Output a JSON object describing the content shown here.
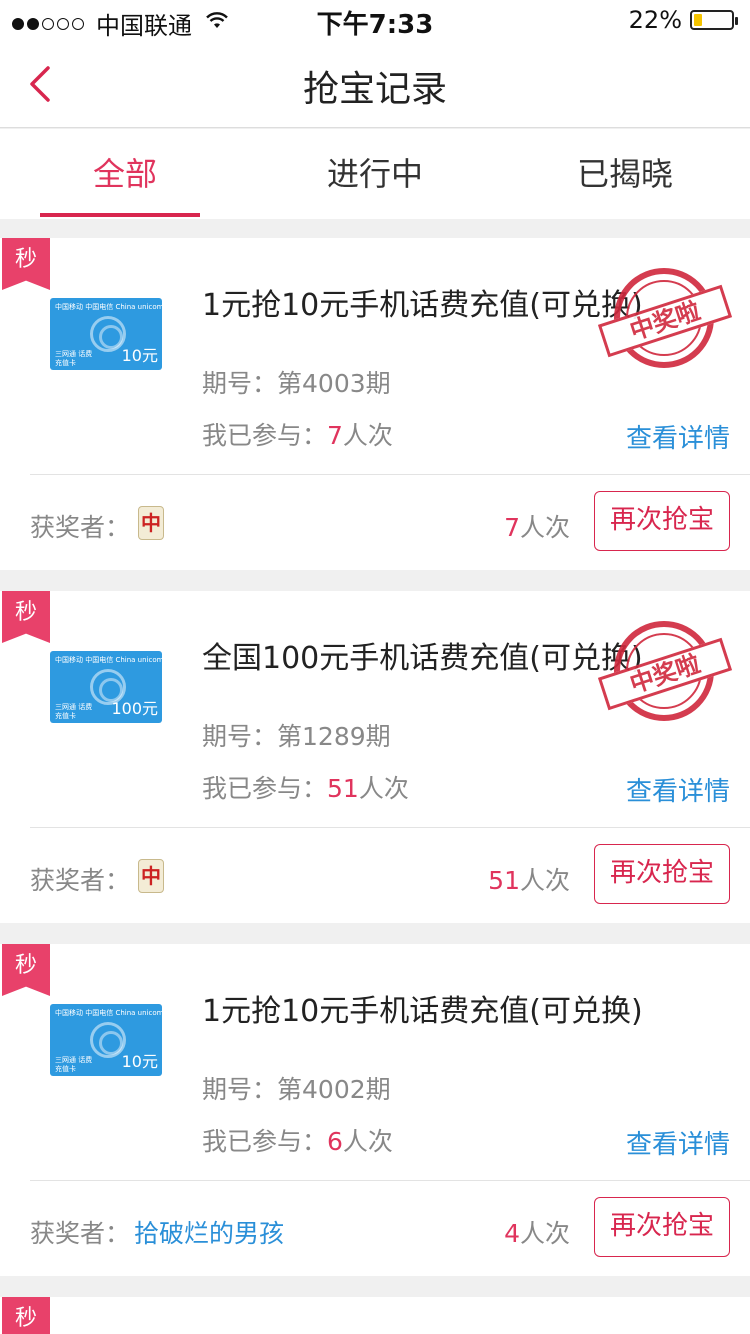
{
  "status_bar": {
    "carrier": "中国联通",
    "time": "下午7:33",
    "battery_text": "22%",
    "battery_level": 0.22
  },
  "nav": {
    "title": "抢宝记录"
  },
  "tabs": [
    {
      "label": "全部",
      "active": true
    },
    {
      "label": "进行中",
      "active": false
    },
    {
      "label": "已揭晓",
      "active": false
    }
  ],
  "common": {
    "flash_tag": "秒",
    "period_label": "期号：",
    "joined_label": "我已参与：",
    "times_unit": "人次",
    "detail_link": "查看详情",
    "winner_label": "获奖者：",
    "again_button": "再次抢宝",
    "stamp_text": "中奖啦",
    "winner_icon_glyph": "中"
  },
  "cards": [
    {
      "title": "1元抢10元手机话费充值(可兑换)",
      "period": "第4003期",
      "joined": "7",
      "winner": "",
      "winner_has_icon": true,
      "win_count": "7",
      "won": true,
      "thumb_value": "10元",
      "thumb_top": "中国移动 中国电信 China unicom",
      "thumb_bottom": "三网通 话费充值卡"
    },
    {
      "title": "全国100元手机话费充值(可兑换)",
      "period": "第1289期",
      "joined": "51",
      "winner": "",
      "winner_has_icon": true,
      "win_count": "51",
      "won": true,
      "thumb_value": "100元",
      "thumb_top": "中国移动 中国电信 China unicom",
      "thumb_bottom": "三网通 话费充值卡"
    },
    {
      "title": "1元抢10元手机话费充值(可兑换)",
      "period": "第4002期",
      "joined": "6",
      "winner": "拾破烂的男孩",
      "winner_has_icon": false,
      "win_count": "4",
      "won": false,
      "thumb_value": "10元",
      "thumb_top": "中国移动 中国电信 China unicom",
      "thumb_bottom": "三网通 话费充值卡"
    }
  ]
}
